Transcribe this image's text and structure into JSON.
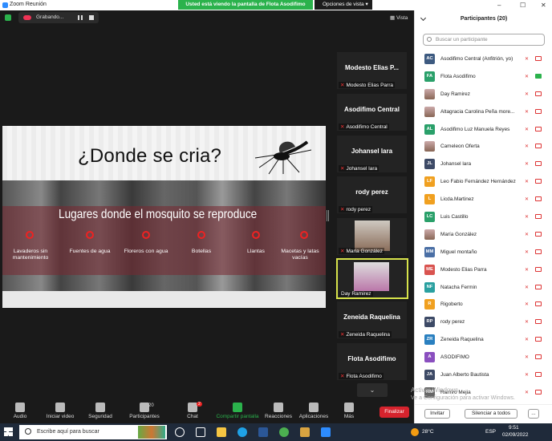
{
  "window": {
    "title": "Zoom Reunión",
    "controls": [
      "–",
      "☐",
      "✕"
    ]
  },
  "share_banner": "Usted está viendo la pantalla de Flota Asodifimo",
  "view_options": "Opciones de vista",
  "recording": {
    "label": "Grabando..."
  },
  "view_button": "Vista",
  "slide": {
    "question": "¿Donde se cria?",
    "subtitle": "Lugares donde el mosquito se reproduce",
    "items": [
      {
        "label": "Lavaderos sin mantenimiento"
      },
      {
        "label": "Fuentes de agua"
      },
      {
        "label": "Floreros con agua"
      },
      {
        "label": "Botellas"
      },
      {
        "label": "Llantas"
      },
      {
        "label": "Macetas y latas vacías"
      }
    ]
  },
  "video_tiles": [
    {
      "name": "Modesto  Elias  P...",
      "caption": "Modesto Elias Parra"
    },
    {
      "name": "Asodifimo Central",
      "caption": "Asodifimo Central"
    },
    {
      "name": "Johansel lara",
      "caption": "Johansel lara"
    },
    {
      "name": "rody perez",
      "caption": "rody perez"
    },
    {
      "name": "",
      "caption": "Maria González"
    },
    {
      "name": "",
      "caption": "Day Ramirez"
    },
    {
      "name": "Zeneida  Raquelina",
      "caption": "Zeneida Raquelina"
    },
    {
      "name": "Flota Asodifimo",
      "caption": "Flota Asodifimo"
    }
  ],
  "toolbar": {
    "audio": "Audio",
    "video": "Iniciar video",
    "security": "Seguridad",
    "participants": "Participantes",
    "participants_count": "20",
    "chat": "Chat",
    "chat_badge": "2",
    "share": "Compartir pantalla",
    "reactions": "Reacciones",
    "apps": "Aplicaciones",
    "more": "Más",
    "end": "Finalizar"
  },
  "participants_panel": {
    "title": "Participantes (20)",
    "search_placeholder": "Buscar un participante",
    "invite": "Invitar",
    "mute_all": "Silenciar a todos",
    "more": "...",
    "list": [
      {
        "initials": "AC",
        "name": "Asodifimo Central (Anfitrión, yo)",
        "color": "#3d5a80",
        "img": false,
        "cam_on": false
      },
      {
        "initials": "FA",
        "name": "Flota Asodifimo",
        "color": "#2aa06a",
        "img": false,
        "cam_on": true
      },
      {
        "initials": "",
        "name": "Day Ramirez",
        "color": "#b87",
        "img": true,
        "cam_on": false
      },
      {
        "initials": "",
        "name": "Altagracia Carolina Peña more...",
        "color": "#b87",
        "img": true,
        "cam_on": false
      },
      {
        "initials": "AL",
        "name": "Asodifimo Luz Manuela Reyes",
        "color": "#2aa06a",
        "img": false,
        "cam_on": false
      },
      {
        "initials": "",
        "name": "Cameleon Oferta",
        "color": "#b87",
        "img": true,
        "cam_on": false
      },
      {
        "initials": "JL",
        "name": "Johansel lara",
        "color": "#3d4a66",
        "img": false,
        "cam_on": false
      },
      {
        "initials": "LF",
        "name": "Leo Fabio Fernández Hernández",
        "color": "#f0a020",
        "img": false,
        "cam_on": false
      },
      {
        "initials": "L",
        "name": "Licda.Martinez",
        "color": "#f0a020",
        "img": false,
        "cam_on": false
      },
      {
        "initials": "LC",
        "name": "Luis Castillo",
        "color": "#2aa06a",
        "img": false,
        "cam_on": false
      },
      {
        "initials": "",
        "name": "María González",
        "color": "#b87",
        "img": true,
        "cam_on": false
      },
      {
        "initials": "MM",
        "name": "Miguel montaño",
        "color": "#4a6fa5",
        "img": false,
        "cam_on": false
      },
      {
        "initials": "ME",
        "name": "Modesto Elias Parra",
        "color": "#d9534f",
        "img": false,
        "cam_on": false
      },
      {
        "initials": "NF",
        "name": "Natacha Fermin",
        "color": "#2aa0a0",
        "img": false,
        "cam_on": false
      },
      {
        "initials": "R",
        "name": "Rigoberto",
        "color": "#f0a020",
        "img": false,
        "cam_on": false
      },
      {
        "initials": "RP",
        "name": "rody perez",
        "color": "#3d4a66",
        "img": false,
        "cam_on": false
      },
      {
        "initials": "ZR",
        "name": "Zeneida Raquelina",
        "color": "#2a80c0",
        "img": false,
        "cam_on": false
      },
      {
        "initials": "A",
        "name": "ASODIFIMO",
        "color": "#8a4fbf",
        "img": false,
        "cam_on": false
      },
      {
        "initials": "JA",
        "name": "Juan Alberto Bautista",
        "color": "#3d4a66",
        "img": false,
        "cam_on": false
      },
      {
        "initials": "RM",
        "name": "Ramiro Mejia",
        "color": "#666",
        "img": false,
        "cam_on": false
      }
    ]
  },
  "watermark": {
    "line1": "Activar Windows",
    "line2": "Ve a Configuración para activar Windows."
  },
  "taskbar": {
    "search_placeholder": "Escribe aquí para buscar",
    "temperature": "28°C",
    "language": "ESP",
    "time": "9:51",
    "date": "02/09/2022"
  }
}
